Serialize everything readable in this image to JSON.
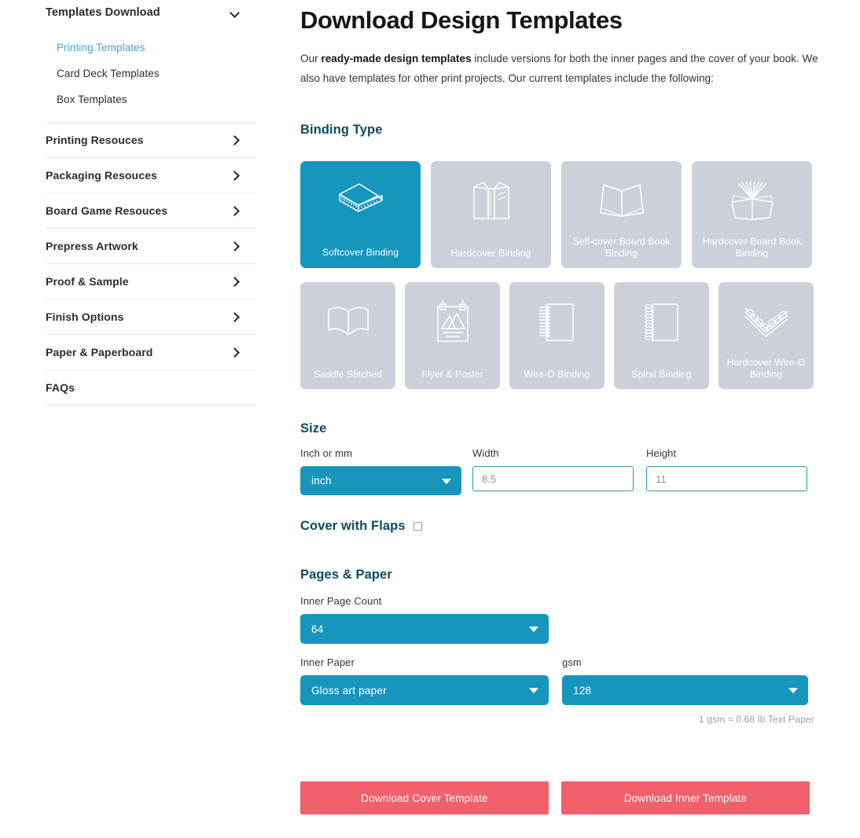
{
  "sidebar": {
    "top": {
      "label": "Templates Download",
      "icon": "chevron-down-icon"
    },
    "sub_items": [
      {
        "label": "Printing Templates",
        "active": true
      },
      {
        "label": "Card Deck Templates",
        "active": false
      },
      {
        "label": "Box Templates",
        "active": false
      }
    ],
    "rows": [
      {
        "label": "Printing Resouces",
        "icon": "chevron-right-icon"
      },
      {
        "label": "Packaging Resouces",
        "icon": "chevron-right-icon"
      },
      {
        "label": "Board Game Resouces",
        "icon": "chevron-right-icon"
      },
      {
        "label": "Prepress Artwork",
        "icon": "chevron-right-icon"
      },
      {
        "label": "Proof & Sample",
        "icon": "chevron-right-icon"
      },
      {
        "label": "Finish Options",
        "icon": "chevron-right-icon"
      },
      {
        "label": "Paper & Paperboard",
        "icon": "chevron-right-icon"
      },
      {
        "label": "FAQs",
        "icon": ""
      }
    ]
  },
  "main": {
    "title": "Download Design Templates",
    "intro_pre": "Our ",
    "intro_bold": "ready-made design templates",
    "intro_post": " include versions for both the inner pages and the cover of your book. We also have templates for other print projects. Our current templates include the following:",
    "binding_heading": "Binding Type",
    "binding_row1": [
      {
        "label": "Softcover Binding",
        "icon": "softcover-book-icon",
        "selected": true
      },
      {
        "label": "Hardcover Binding",
        "icon": "hardcover-book-icon",
        "selected": false
      },
      {
        "label": "Self-cover Board Book Binding",
        "icon": "open-board-book-icon",
        "selected": false
      },
      {
        "label": "Hardcover Board Book Binding",
        "icon": "fanned-board-book-icon",
        "selected": false
      }
    ],
    "binding_row2": [
      {
        "label": "Saddle Stitched",
        "icon": "open-book-icon",
        "selected": false
      },
      {
        "label": "Flyer & Poster",
        "icon": "poster-icon",
        "selected": false
      },
      {
        "label": "Wire-O Binding",
        "icon": "wire-o-notebook-icon",
        "selected": false
      },
      {
        "label": "Spiral Binding",
        "icon": "spiral-notebook-icon",
        "selected": false
      },
      {
        "label": "Hardcover Wire-O Binding",
        "icon": "hardcover-wire-o-icon",
        "selected": false
      }
    ],
    "size": {
      "heading": "Size",
      "unit_label": "Inch or mm",
      "unit_value": "inch",
      "width_label": "Width",
      "width_placeholder": "8.5",
      "width_value": "",
      "height_label": "Height",
      "height_placeholder": "11",
      "height_value": ""
    },
    "flaps": {
      "label": "Cover with Flaps",
      "checked": false
    },
    "pages": {
      "heading": "Pages & Paper",
      "inner_page_count_label": "Inner Page Count",
      "inner_page_count_value": "64",
      "inner_paper_label": "Inner Paper",
      "inner_paper_value": "Gloss art paper",
      "gsm_label": "gsm",
      "gsm_value": "128",
      "note": "1 gsm ≈ 0.68 lb Text Paper"
    },
    "buttons": {
      "cover": "Download Cover Template",
      "inner": "Download Inner Template"
    }
  },
  "colors": {
    "accent_teal": "#1796bd",
    "heading_teal": "#0c4a5e",
    "card_gray": "#ccd1d9",
    "button_pink": "#f1606b",
    "link_blue": "#45a6cc"
  }
}
